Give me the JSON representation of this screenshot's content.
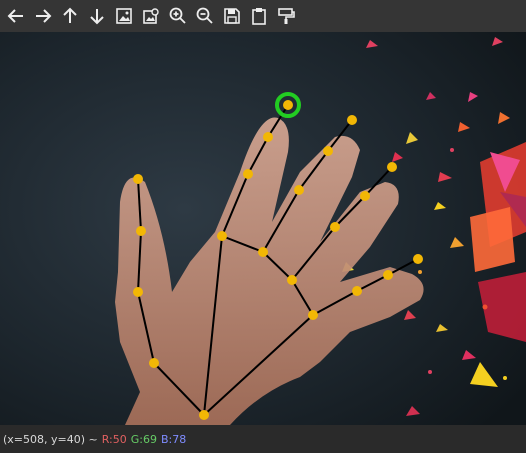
{
  "toolbar": {
    "buttons": [
      {
        "name": "pan-left-button",
        "icon": "arrow-left-icon"
      },
      {
        "name": "pan-right-button",
        "icon": "arrow-right-icon"
      },
      {
        "name": "pan-up-button",
        "icon": "arrow-up-icon"
      },
      {
        "name": "pan-down-button",
        "icon": "arrow-down-icon"
      },
      {
        "name": "zoom-fit-button",
        "icon": "image-icon"
      },
      {
        "name": "zoom-actual-button",
        "icon": "image-zoom-icon"
      },
      {
        "name": "zoom-in-button",
        "icon": "zoom-in-icon"
      },
      {
        "name": "zoom-out-button",
        "icon": "zoom-out-icon"
      },
      {
        "name": "save-button",
        "icon": "floppy-disk-icon"
      },
      {
        "name": "copy-button",
        "icon": "clipboard-icon"
      },
      {
        "name": "properties-button",
        "icon": "paint-roller-icon"
      }
    ]
  },
  "status": {
    "coords": "(x=508, y=40) ~",
    "r": "R:50",
    "g": "G:69",
    "b": "B:78",
    "colors": {
      "text": "#d8d8d8",
      "r": "#e06060",
      "g": "#66cc66",
      "b": "#7f8cff"
    }
  },
  "overlay": {
    "landmark_color": "#f2b705",
    "line_color": "#000000",
    "highlight_color": "#22cc22"
  }
}
